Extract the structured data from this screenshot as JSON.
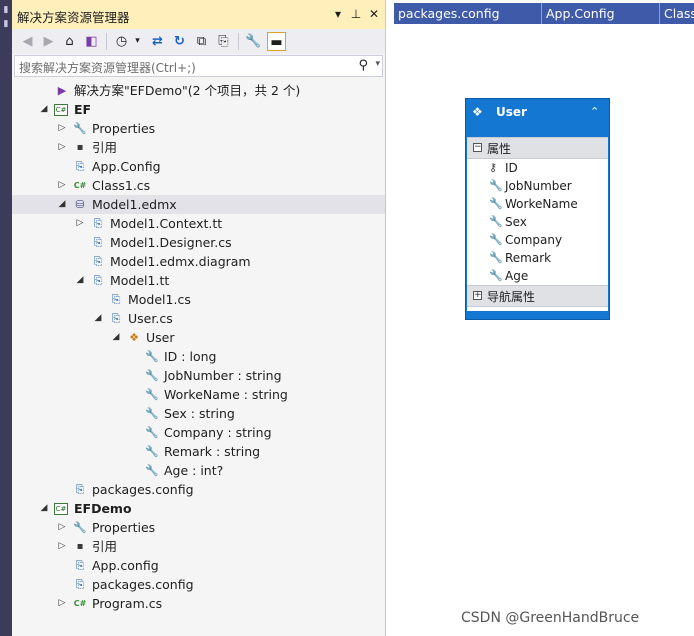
{
  "solution_explorer": {
    "title": "解决方案资源管理器",
    "title_buttons": [
      "▾",
      "⊥",
      "✕"
    ],
    "search_placeholder": "搜索解决方案资源管理器(Ctrl+;)",
    "tree": [
      {
        "label": "解决方案\"EFDemo\"(2 个项目，共 2 个)",
        "icon": "solution-icon",
        "glyph": "▶",
        "expander": "",
        "depth": 0,
        "bold": false,
        "selected": false
      },
      {
        "label": "EF",
        "icon": "csharp-project-icon",
        "glyph": "C#",
        "expander": "◢",
        "depth": 0,
        "bold": true,
        "selected": false
      },
      {
        "label": "Properties",
        "icon": "wrench-icon",
        "glyph": "🔧",
        "expander": "▷",
        "depth": 1,
        "bold": false,
        "selected": false
      },
      {
        "label": "引用",
        "icon": "references-icon",
        "glyph": "▪",
        "expander": "▷",
        "depth": 1,
        "bold": false,
        "selected": false
      },
      {
        "label": "App.Config",
        "icon": "config-file-icon",
        "glyph": "⎘",
        "expander": "",
        "depth": 1,
        "bold": false,
        "selected": false
      },
      {
        "label": "Class1.cs",
        "icon": "csharp-file-icon",
        "glyph": "C#",
        "expander": "▷",
        "depth": 1,
        "bold": false,
        "selected": false
      },
      {
        "label": "Model1.edmx",
        "icon": "edmx-file-icon",
        "glyph": "⛁",
        "expander": "◢",
        "depth": 1,
        "bold": false,
        "selected": true
      },
      {
        "label": "Model1.Context.tt",
        "icon": "tt-file-icon",
        "glyph": "⎘",
        "expander": "▷",
        "depth": 2,
        "bold": false,
        "selected": false
      },
      {
        "label": "Model1.Designer.cs",
        "icon": "designer-file-icon",
        "glyph": "⎘",
        "expander": "",
        "depth": 2,
        "bold": false,
        "selected": false
      },
      {
        "label": "Model1.edmx.diagram",
        "icon": "diagram-file-icon",
        "glyph": "⎘",
        "expander": "",
        "depth": 2,
        "bold": false,
        "selected": false
      },
      {
        "label": "Model1.tt",
        "icon": "tt-file-icon",
        "glyph": "⎘",
        "expander": "◢",
        "depth": 2,
        "bold": false,
        "selected": false
      },
      {
        "label": "Model1.cs",
        "icon": "cs-file-icon",
        "glyph": "⎘",
        "expander": "",
        "depth": 3,
        "bold": false,
        "selected": false
      },
      {
        "label": "User.cs",
        "icon": "cs-file-icon",
        "glyph": "⎘",
        "expander": "◢",
        "depth": 3,
        "bold": false,
        "selected": false
      },
      {
        "label": "User",
        "icon": "class-icon",
        "glyph": "❖",
        "expander": "◢",
        "depth": 4,
        "bold": false,
        "selected": false
      },
      {
        "label": "ID : long",
        "icon": "property-wrench-icon",
        "glyph": "🔧",
        "expander": "",
        "depth": 5,
        "bold": false,
        "selected": false
      },
      {
        "label": "JobNumber : string",
        "icon": "property-wrench-icon",
        "glyph": "🔧",
        "expander": "",
        "depth": 5,
        "bold": false,
        "selected": false
      },
      {
        "label": "WorkeName : string",
        "icon": "property-wrench-icon",
        "glyph": "🔧",
        "expander": "",
        "depth": 5,
        "bold": false,
        "selected": false
      },
      {
        "label": "Sex : string",
        "icon": "property-wrench-icon",
        "glyph": "🔧",
        "expander": "",
        "depth": 5,
        "bold": false,
        "selected": false
      },
      {
        "label": "Company : string",
        "icon": "property-wrench-icon",
        "glyph": "🔧",
        "expander": "",
        "depth": 5,
        "bold": false,
        "selected": false
      },
      {
        "label": "Remark : string",
        "icon": "property-wrench-icon",
        "glyph": "🔧",
        "expander": "",
        "depth": 5,
        "bold": false,
        "selected": false
      },
      {
        "label": "Age : int?",
        "icon": "property-wrench-icon",
        "glyph": "🔧",
        "expander": "",
        "depth": 5,
        "bold": false,
        "selected": false
      },
      {
        "label": "packages.config",
        "icon": "config-file-icon",
        "glyph": "⎘",
        "expander": "",
        "depth": 1,
        "bold": false,
        "selected": false
      },
      {
        "label": "EFDemo",
        "icon": "csharp-project-icon",
        "glyph": "C#",
        "expander": "◢",
        "depth": 0,
        "bold": true,
        "selected": false
      },
      {
        "label": "Properties",
        "icon": "wrench-icon",
        "glyph": "🔧",
        "expander": "▷",
        "depth": 1,
        "bold": false,
        "selected": false
      },
      {
        "label": "引用",
        "icon": "references-icon",
        "glyph": "▪",
        "expander": "▷",
        "depth": 1,
        "bold": false,
        "selected": false
      },
      {
        "label": "App.config",
        "icon": "config-file-icon",
        "glyph": "⎘",
        "expander": "",
        "depth": 1,
        "bold": false,
        "selected": false
      },
      {
        "label": "packages.config",
        "icon": "config-file-icon",
        "glyph": "⎘",
        "expander": "",
        "depth": 1,
        "bold": false,
        "selected": false
      },
      {
        "label": "Program.cs",
        "icon": "csharp-file-icon",
        "glyph": "C#",
        "expander": "▷",
        "depth": 1,
        "bold": false,
        "selected": false
      }
    ]
  },
  "editor_tabs": [
    "packages.config",
    "App.Config",
    "Class"
  ],
  "entity": {
    "name": "User",
    "properties_section": "属性",
    "properties": [
      "ID",
      "JobNumber",
      "WorkeName",
      "Sex",
      "Company",
      "Remark",
      "Age"
    ],
    "key_property": "ID",
    "navigation_section": "导航属性",
    "header_color": "#1478d2"
  },
  "watermark": "CSDN @GreenHandBruce"
}
